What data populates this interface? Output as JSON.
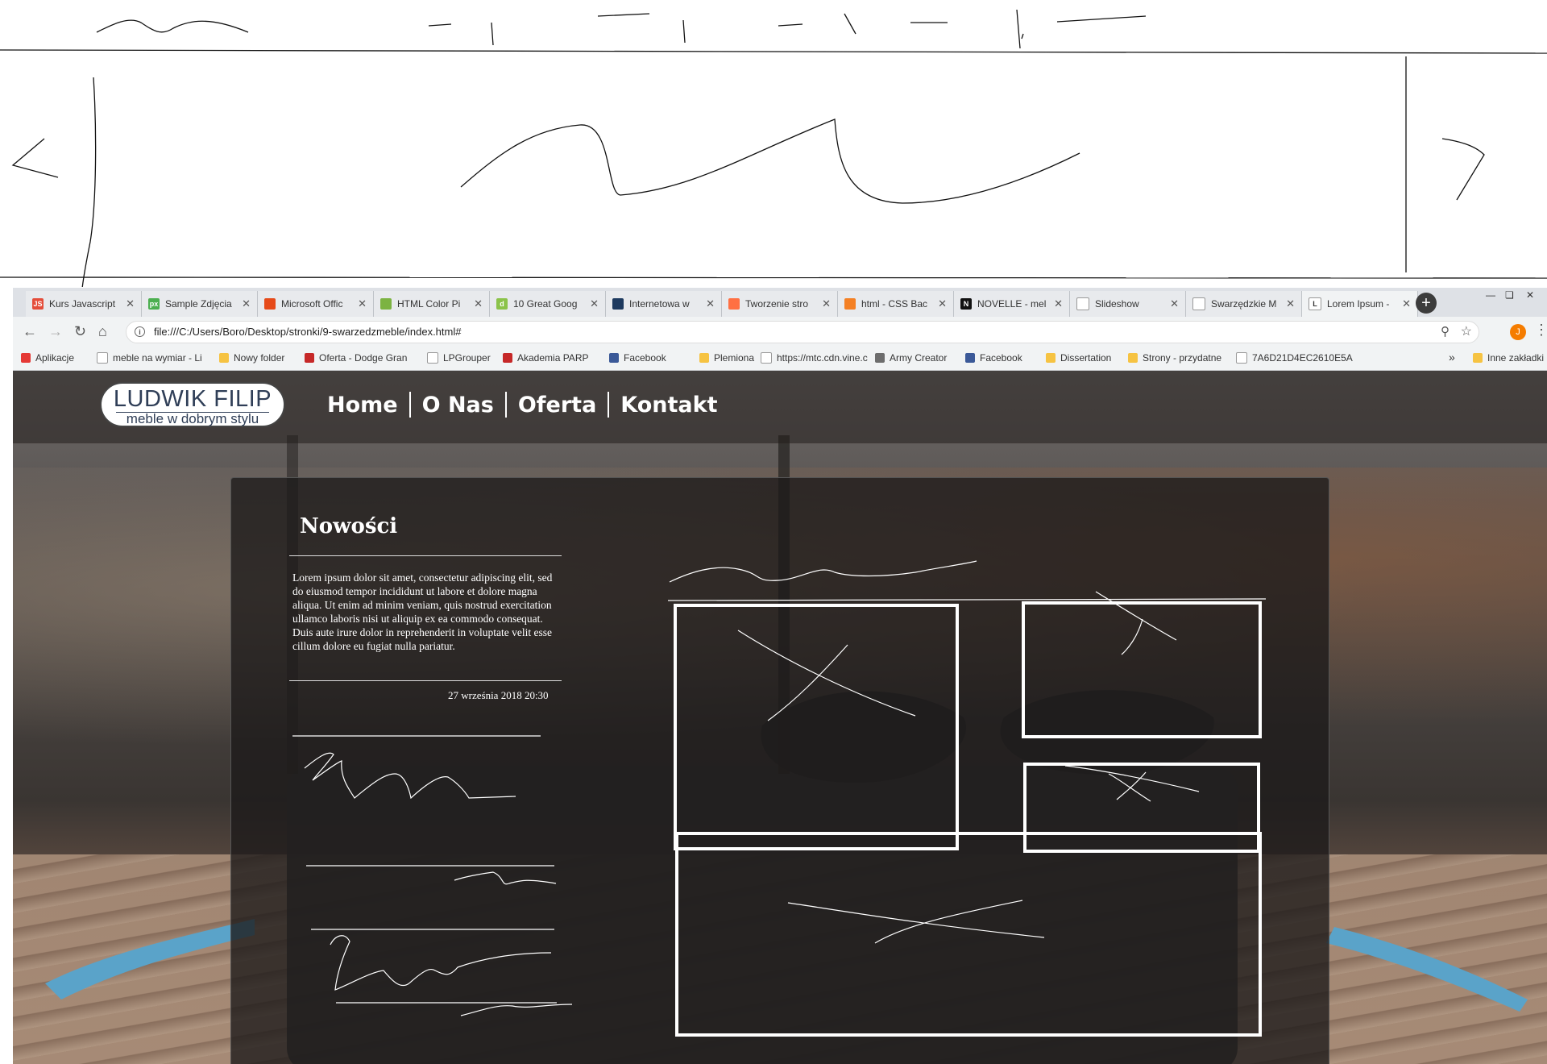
{
  "browser": {
    "tabs": [
      {
        "label": "Kurs Javascript",
        "icon": "js-icon",
        "color": "#e44d3a",
        "glyph": "JS"
      },
      {
        "label": "Sample Zdjęcia",
        "icon": "px-icon",
        "color": "#4caf50",
        "glyph": "px"
      },
      {
        "label": "Microsoft Offic",
        "icon": "office-icon",
        "color": "#e64a19",
        "glyph": ""
      },
      {
        "label": "HTML Color Pi",
        "icon": "color-icon",
        "color": "#7cb342",
        "glyph": ""
      },
      {
        "label": "10 Great Goog",
        "icon": "doc-icon",
        "color": "#8bc34a",
        "glyph": "d"
      },
      {
        "label": "Internetowa w",
        "icon": "shield-icon",
        "color": "#1e3a5f",
        "glyph": ""
      },
      {
        "label": "Tworzenie stro",
        "icon": "orange-icon",
        "color": "#ff7043",
        "glyph": ""
      },
      {
        "label": "html - CSS Bac",
        "icon": "stack-icon",
        "color": "#f48024",
        "glyph": ""
      },
      {
        "label": "NOVELLE - mel",
        "icon": "n-icon",
        "color": "#111111",
        "glyph": "N"
      },
      {
        "label": "Slideshow",
        "icon": "page-icon",
        "color": "#ffffff",
        "glyph": ""
      },
      {
        "label": "Swarzędzkie M",
        "icon": "page-icon",
        "color": "#ffffff",
        "glyph": ""
      },
      {
        "label": "Lorem Ipsum -",
        "icon": "l-icon",
        "color": "#ffffff",
        "glyph": "L"
      }
    ],
    "new_tab": "+",
    "url": "file:///C:/Users/Boro/Desktop/stronki/9-swarzedzmeble/index.html#",
    "bookmarks": [
      {
        "label": "Aplikacje",
        "color": "#e53935"
      },
      {
        "label": "meble na wymiar - Li",
        "color": "#ffffff"
      },
      {
        "label": "Nowy folder",
        "color": "#f6c342"
      },
      {
        "label": "Oferta - Dodge Gran",
        "color": "#c62828"
      },
      {
        "label": "LPGrouper",
        "color": "#ffffff"
      },
      {
        "label": "Akademia PARP",
        "color": "#c62828"
      },
      {
        "label": "Facebook",
        "color": "#3b5998"
      },
      {
        "label": "Plemiona",
        "color": "#f6c342"
      },
      {
        "label": "https://mtc.cdn.vine.c",
        "color": "#ffffff"
      },
      {
        "label": "Army Creator",
        "color": "#6d6d6d"
      },
      {
        "label": "Facebook",
        "color": "#3b5998"
      },
      {
        "label": "Dissertation",
        "color": "#f6c342"
      },
      {
        "label": "Strony - przydatne",
        "color": "#f6c342"
      },
      {
        "label": "7A6D21D4EC2610E5A",
        "color": "#ffffff"
      }
    ],
    "bookmarks_more": "»",
    "other_bookmarks": "Inne zakładki",
    "profile_initial": "J"
  },
  "site": {
    "logo_title": "LUDWIK FILIP",
    "logo_subtitle": "meble w dobrym stylu",
    "menu": [
      "Home",
      "O Nas",
      "Oferta",
      "Kontakt"
    ],
    "news": {
      "title": "Nowości",
      "text": "Lorem ipsum dolor sit amet, consectetur adipiscing elit, sed do eiusmod tempor incididunt ut labore et dolore magna aliqua. Ut enim ad minim veniam, quis nostrud exercitation ullamco laboris nisi ut aliquip ex ea commodo consequat. Duis aute irure dolor in reprehenderit in voluptate velit esse cillum dolore eu fugiat nulla pariatur.",
      "date": "27 września 2018 20:30"
    }
  }
}
